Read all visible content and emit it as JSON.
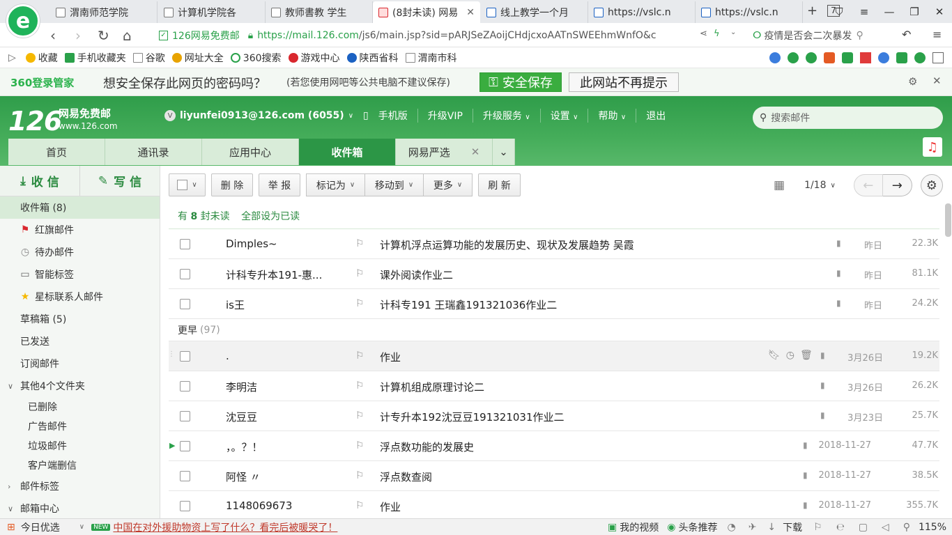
{
  "browser": {
    "tabs": [
      {
        "label": "渭南师范学院"
      },
      {
        "label": "计算机学院各"
      },
      {
        "label": "教师書教 学生"
      },
      {
        "label": "(8封未读) 网易"
      },
      {
        "label": "线上教学一个月"
      },
      {
        "label": "https://vslc.n"
      },
      {
        "label": "https://vslc.n"
      }
    ],
    "tab_count": "7",
    "site_name": "126网易免费邮",
    "url_scheme": "https://",
    "url_host": "mail.126.com",
    "url_path": "/js6/main.jsp?sid=pARJSeZAoijCHdjcxoAATnSWEEhmWnfO&c",
    "search_text": "疫情是否会二次暴发"
  },
  "bookmarks": [
    {
      "label": "收藏",
      "color": "#f5b800"
    },
    {
      "label": "手机收藏夹",
      "color": "#2aa14a"
    },
    {
      "label": "谷歌",
      "color": "#888888"
    },
    {
      "label": "网址大全",
      "color": "#e8a300"
    },
    {
      "label": "360搜索",
      "color": "#2aa14a"
    },
    {
      "label": "游戏中心",
      "color": "#d9272e"
    },
    {
      "label": "陕西省科",
      "color": "#1b61c2"
    },
    {
      "label": "渭南市科",
      "color": "#888888"
    }
  ],
  "pwbar": {
    "brand": "360登录管家",
    "question": "想安全保存此网页的密码吗？",
    "hint": "(若您使用网吧等公共电脑不建议保存)",
    "save": "安全保存",
    "never": "此网站不再提示"
  },
  "mail": {
    "logo_num": "126",
    "logo_name": "网易免费邮",
    "logo_domain": "www.126.com",
    "account": "liyunfei0913@126.com (6055)",
    "nav": [
      "手机版",
      "升级VIP",
      "升级服务",
      "设置",
      "帮助",
      "退出"
    ],
    "search_placeholder": "搜索邮件",
    "tabs": [
      "首页",
      "通讯录",
      "应用中心",
      "收件箱",
      "网易严选"
    ],
    "receive": "收 信",
    "compose": "写 信"
  },
  "folders": [
    {
      "label": "收件箱 (8)"
    },
    {
      "label": "红旗邮件"
    },
    {
      "label": "待办邮件"
    },
    {
      "label": "智能标签"
    },
    {
      "label": "星标联系人邮件"
    },
    {
      "label": "草稿箱 (5)"
    },
    {
      "label": "已发送"
    },
    {
      "label": "订阅邮件"
    },
    {
      "label": "其他4个文件夹"
    },
    {
      "label": "已删除"
    },
    {
      "label": "广告邮件"
    },
    {
      "label": "垃圾邮件"
    },
    {
      "label": "客户端删信"
    },
    {
      "label": "邮件标签"
    },
    {
      "label": "邮箱中心"
    }
  ],
  "toolbar": {
    "delete": "删 除",
    "report": "举 报",
    "mark": "标记为",
    "move": "移动到",
    "more": "更多",
    "refresh": "刷 新",
    "page": "1/18"
  },
  "unread": {
    "prefix": "有",
    "count": "8",
    "suffix": "封未读",
    "mark_all": "全部设为已读"
  },
  "group_earlier": {
    "label": "更早",
    "count": "(97)"
  },
  "emails_recent": [
    {
      "sender": "Dimples~",
      "subject": "计算机浮点运算功能的发展历史、现状及发展趋势 吴霞",
      "date": "昨日",
      "size": "22.3K"
    },
    {
      "sender": "计科专升本191-惠...",
      "subject": "课外阅读作业二",
      "date": "昨日",
      "size": "81.1K"
    },
    {
      "sender": "is王",
      "subject": "计科专191 王瑞鑫191321036作业二",
      "date": "昨日",
      "size": "24.2K"
    }
  ],
  "emails_earlier": [
    {
      "sender": ".",
      "subject": "作业",
      "date": "3月26日",
      "size": "19.2K"
    },
    {
      "sender": "李明洁",
      "subject": "计算机组成原理讨论二",
      "date": "3月26日",
      "size": "26.2K"
    },
    {
      "sender": "沈豆豆",
      "subject": "计专升本192沈豆豆191321031作业二",
      "date": "3月23日",
      "size": "25.7K"
    },
    {
      "sender": "，。？！",
      "subject": "浮点数功能的发展史",
      "date": "2018-11-27",
      "size": "47.7K"
    },
    {
      "sender": "阿怪 〃",
      "subject": "浮点数查阅",
      "date": "2018-11-27",
      "size": "38.5K"
    },
    {
      "sender": "1148069673",
      "subject": "作业",
      "date": "2018-11-27",
      "size": "355.7K"
    }
  ],
  "status": {
    "today": "今日优选",
    "new_badge": "NEW",
    "headline": "中国在对外援助物资上写了什么？看完后被暖哭了！",
    "video": "我的视频",
    "toutiao": "头条推荐",
    "download": "下载",
    "zoom": "115%"
  },
  "colors": {
    "brand_green": "#2c9646",
    "link_green": "#2a8a3f"
  }
}
